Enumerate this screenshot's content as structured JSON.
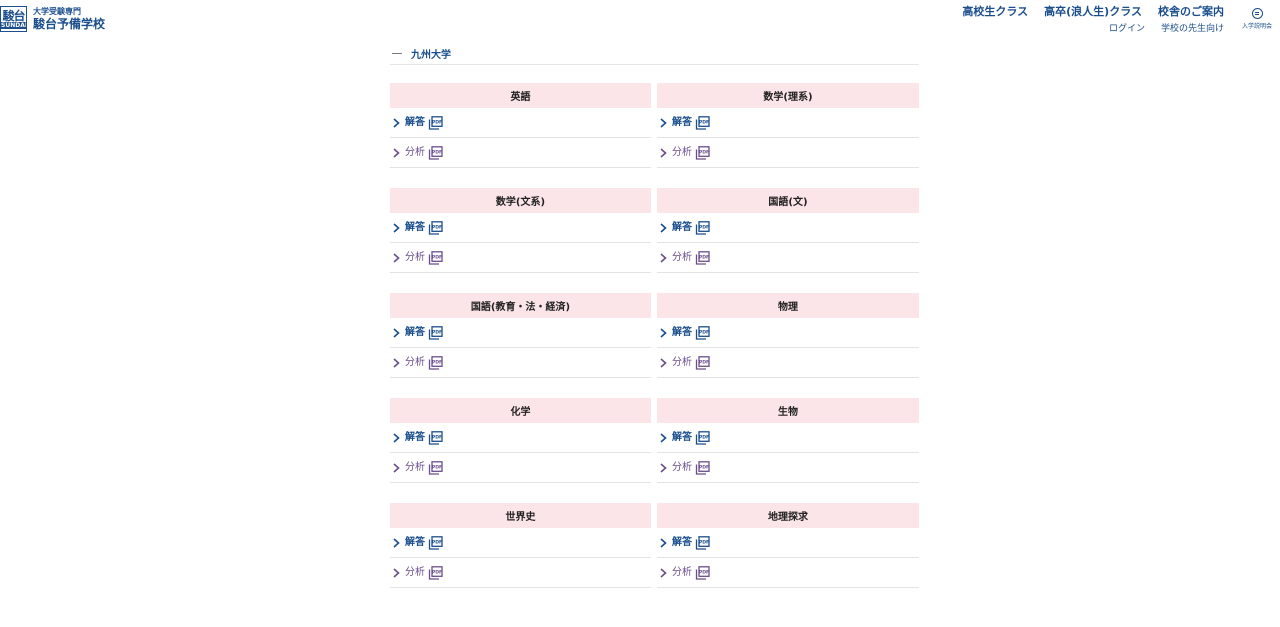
{
  "header": {
    "logo_kanji": "駿台",
    "logo_roman": "SUNDAI",
    "logo_sub": "大学受験専門",
    "logo_main": "駿台予備学校",
    "nav_main": [
      "高校生クラス",
      "高卒(浪人生)クラス",
      "校舎のご案内"
    ],
    "nav_sub": [
      "ログイン",
      "学校の先生向け"
    ],
    "info_label": "入学説明会"
  },
  "breadcrumb": {
    "current": "九州大学"
  },
  "link_labels": {
    "answer": "解答",
    "analysis": "分析"
  },
  "colors": {
    "brand": "#1a4e8c",
    "header_bg": "#fce5e8",
    "analysis": "#6a4e8c"
  },
  "subjects": [
    {
      "name": "英語"
    },
    {
      "name": "数学(理系)"
    },
    {
      "name": "数学(文系)"
    },
    {
      "name": "国語(文)"
    },
    {
      "name": "国語(教育・法・経済)"
    },
    {
      "name": "物理"
    },
    {
      "name": "化学"
    },
    {
      "name": "生物"
    },
    {
      "name": "世界史"
    },
    {
      "name": "地理探求"
    }
  ]
}
